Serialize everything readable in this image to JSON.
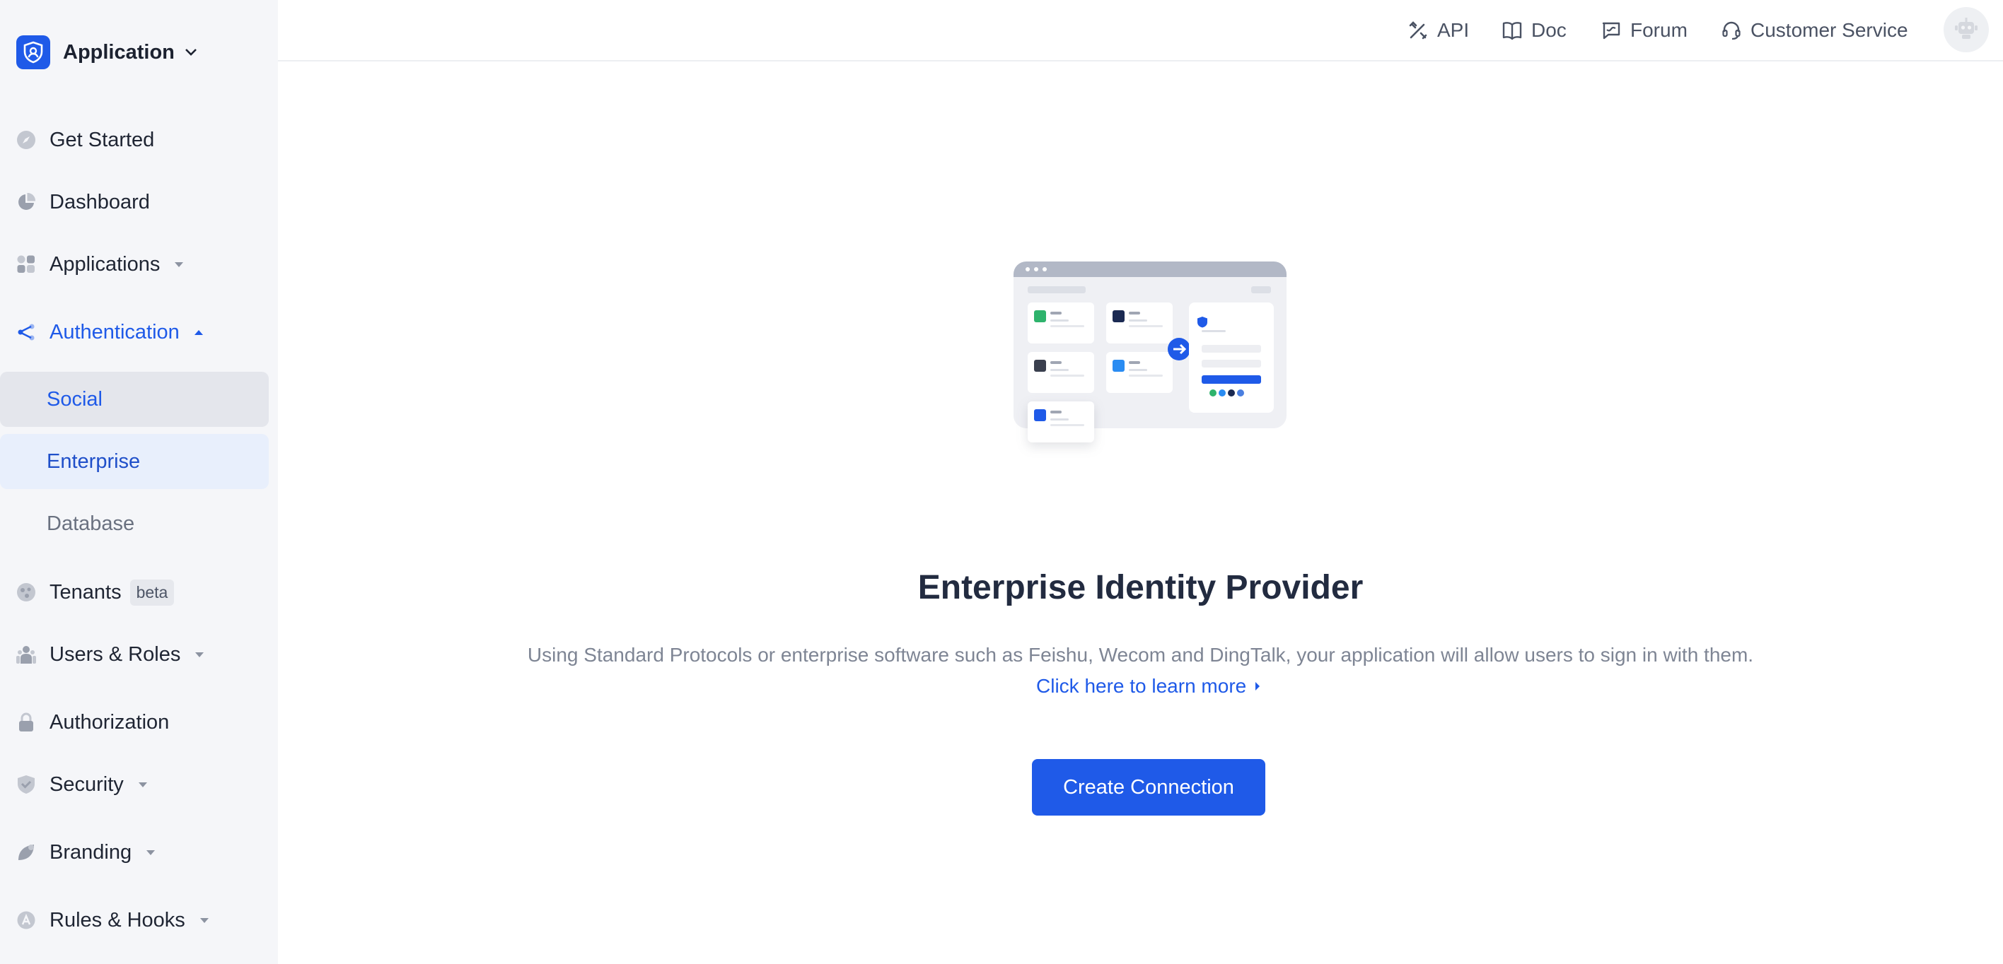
{
  "brand": {
    "name": "Application"
  },
  "nav": {
    "get_started": "Get Started",
    "dashboard": "Dashboard",
    "applications": "Applications",
    "authentication": "Authentication",
    "authentication_sub": {
      "social": "Social",
      "enterprise": "Enterprise",
      "database": "Database"
    },
    "tenants": "Tenants",
    "tenants_badge": "beta",
    "users_roles": "Users & Roles",
    "authorization": "Authorization",
    "security": "Security",
    "branding": "Branding",
    "rules_hooks": "Rules & Hooks"
  },
  "topbar": {
    "api": "API",
    "doc": "Doc",
    "forum": "Forum",
    "customer_service": "Customer Service"
  },
  "empty_state": {
    "title": "Enterprise Identity Provider",
    "description": "Using Standard Protocols or enterprise software such as Feishu, Wecom and DingTalk, your application will allow users to sign in with them.",
    "learn_more": "Click here to learn more",
    "button": "Create Connection"
  },
  "colors": {
    "accent": "#1f5ae8",
    "sidebar_bg": "#f5f6f9",
    "selected_bg": "#e8effc"
  },
  "icons": {
    "brand": "shield-logo-icon",
    "get_started": "compass-icon",
    "dashboard": "pie-chart-icon",
    "applications": "apps-grid-icon",
    "authentication": "share-icon",
    "tenants": "globe-icon",
    "users_roles": "users-icon",
    "authorization": "lock-icon",
    "security": "shield-check-icon",
    "branding": "leaf-icon",
    "rules_hooks": "rules-icon",
    "api": "tools-icon",
    "doc": "book-icon",
    "forum": "message-icon",
    "customer_service": "headset-icon",
    "avatar": "robot-avatar-icon"
  }
}
